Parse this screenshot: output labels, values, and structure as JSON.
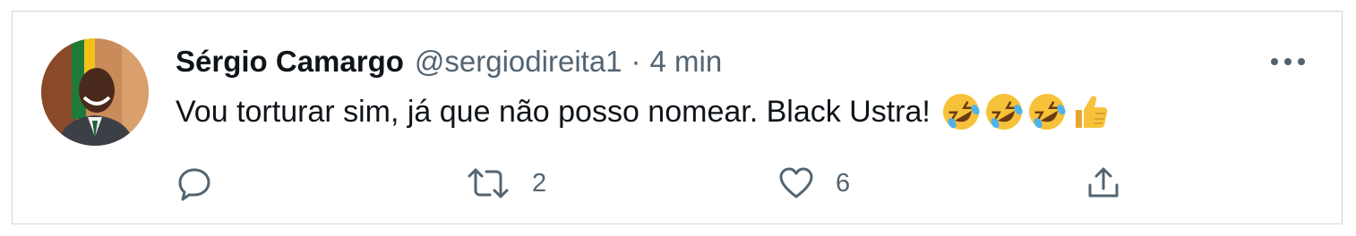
{
  "tweet": {
    "display_name": "Sérgio Camargo",
    "handle": "@sergiodireita1",
    "separator": "·",
    "time": "4 min",
    "text": "Vou torturar sim, já que não posso nomear. Black Ustra!",
    "emojis": [
      "rolling-on-the-floor-laughing",
      "rolling-on-the-floor-laughing",
      "rolling-on-the-floor-laughing",
      "thumbs-up"
    ],
    "actions": {
      "reply_count": "",
      "retweet_count": "2",
      "like_count": "6"
    }
  },
  "colors": {
    "text": "#0f1419",
    "secondary": "#536471",
    "border": "#cfd9de"
  }
}
